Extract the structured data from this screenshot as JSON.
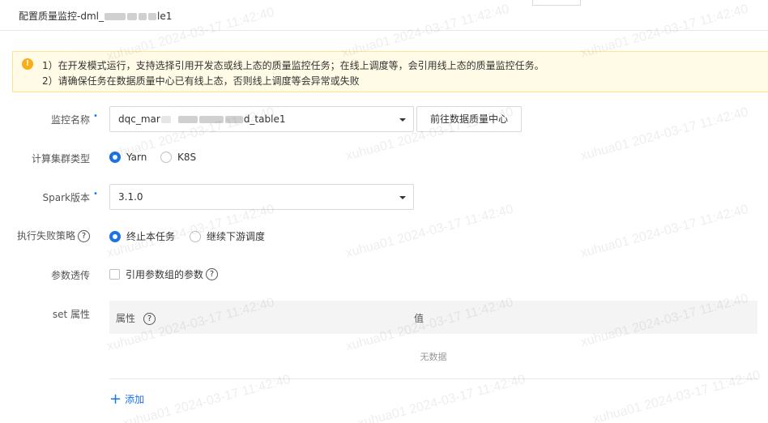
{
  "header": {
    "title_prefix": "配置质量监控-dml_",
    "title_suffix": "le1"
  },
  "alert": {
    "icon": "warning-icon",
    "line1": "1）在开发模式运行，支持选择引用开发态或线上态的质量监控任务；在线上调度等，会引用线上态的质量监控任务。",
    "line2": "2）请确保任务在数据质量中心已有线上态，否则线上调度等会异常或失败"
  },
  "form": {
    "monitor_name": {
      "label": "监控名称",
      "value_prefix": "dqc_mar",
      "value_suffix": "d_table1",
      "button": "前往数据质量中心"
    },
    "cluster_type": {
      "label": "计算集群类型",
      "options": [
        "Yarn",
        "K8S"
      ],
      "selected": "Yarn"
    },
    "spark_version": {
      "label": "Spark版本",
      "value": "3.1.0"
    },
    "failure_policy": {
      "label": "执行失败策略",
      "options": [
        "终止本任务",
        "继续下游调度"
      ],
      "selected": "终止本任务"
    },
    "param_pass": {
      "label": "参数透传",
      "checkbox_label": "引用参数组的参数",
      "checked": false
    },
    "set_props": {
      "label": "set 属性",
      "columns": [
        "属性",
        "值"
      ],
      "empty_text": "无数据",
      "add_label": "添加"
    }
  },
  "watermark": "xuhua01 2024-03-17 11:42:40",
  "colors": {
    "primary": "#1a73e8",
    "warning": "#faad14",
    "alert_bg": "#fffbe6"
  }
}
